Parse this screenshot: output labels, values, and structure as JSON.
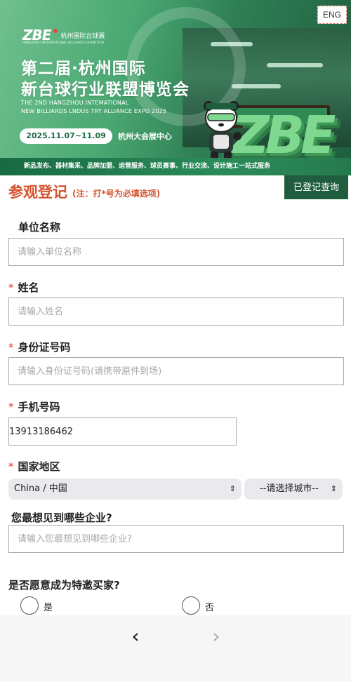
{
  "banner": {
    "brand_logo": "ZBE",
    "brand_cn": "杭州国际台球展",
    "brand_en": "HANGZHOU INTERNATIONAL BILLIARDS EXHIBITION",
    "title_line1": "第二届·杭州国际",
    "title_line2": "新台球行业联盟博览会",
    "en_line1": "THE 2ND HANGZHOU INTEMATIONAL",
    "en_line2": "NEW BILLIARDS LNDUS TRY ALLIANCE EXPO 2025",
    "date": "2025.11.07~11.09",
    "venue": "杭州大会展中心",
    "big_logo": "ZBE",
    "services": "新品发布、器材集采、品牌加盟、运营服务、球员赛事、行业交流、设计施工一站式服务"
  },
  "lang_button": "ENG",
  "header": {
    "title": "参观登记",
    "note": "(注：打*号为必填选项)",
    "query_button": "已登记查询"
  },
  "form": {
    "company": {
      "label": "单位名称",
      "placeholder": "请输入单位名称",
      "value": ""
    },
    "name": {
      "required_mark": "*",
      "label": "姓名",
      "placeholder": "请输入姓名",
      "value": ""
    },
    "id_number": {
      "required_mark": "*",
      "label": "身份证号码",
      "placeholder": "请输入身份证号码(请携带原件到场)",
      "value": ""
    },
    "phone": {
      "required_mark": "*",
      "label": "手机号码",
      "placeholder": "",
      "value": "13913186462"
    },
    "region": {
      "required_mark": "*",
      "label": "国家地区",
      "country_selected": "China / 中国",
      "city_selected": "--请选择城市--"
    },
    "companies_wish": {
      "label": "您最想见到哪些企业?",
      "placeholder": "请输入您最想见到哪些企业?",
      "value": ""
    },
    "special_buyer": {
      "label": "是否愿意成为特邀买家?",
      "options": [
        "是",
        "否"
      ]
    }
  },
  "bottom_nav": {
    "back_icon": "‹",
    "forward_icon": "›"
  }
}
